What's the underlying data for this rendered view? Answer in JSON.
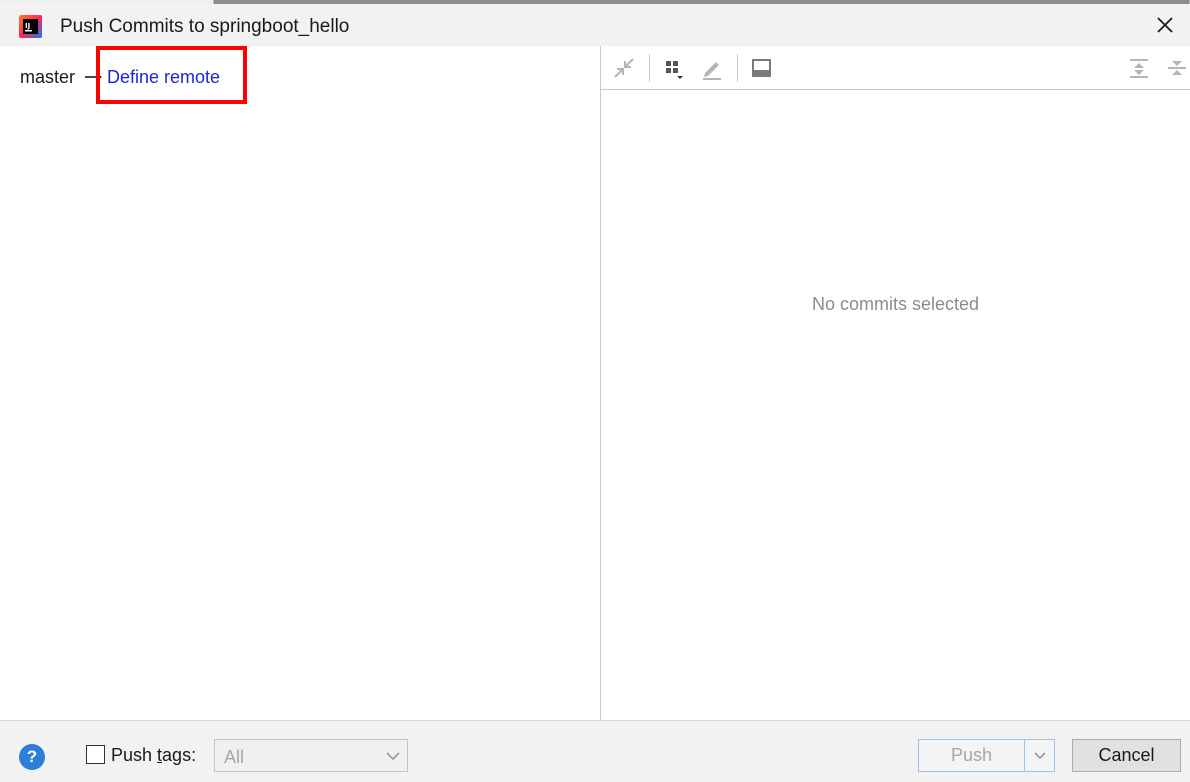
{
  "window": {
    "title": "Push Commits to springboot_hello",
    "app_icon": "intellij-idea-icon",
    "close_icon": "close-icon"
  },
  "left_pane": {
    "branch": "master",
    "arrow_icon": "arrow-right-icon",
    "define_remote_link": "Define remote",
    "highlight_color": "#ff0000",
    "link_color": "#1d27d6"
  },
  "right_pane": {
    "toolbar": [
      {
        "name": "collapse-arrows-icon",
        "enabled": false
      },
      {
        "name": "group-by-icon",
        "enabled": true
      },
      {
        "name": "edit-icon",
        "enabled": false
      },
      {
        "name": "preview-icon",
        "enabled": true
      },
      {
        "name": "expand-all-icon",
        "enabled": false
      },
      {
        "name": "collapse-all-icon",
        "enabled": false
      }
    ],
    "empty_message": "No commits selected"
  },
  "footer": {
    "help_icon": "help-icon",
    "help_glyph": "?",
    "push_tags_label_pre": "Push ",
    "push_tags_label_underlined": "t",
    "push_tags_label_post": "ags:",
    "push_tags_checked": false,
    "tags_select_value": "All",
    "push_button": "Push",
    "push_enabled": false,
    "cancel_button": "Cancel",
    "accent_color": "#2c7fd6"
  }
}
